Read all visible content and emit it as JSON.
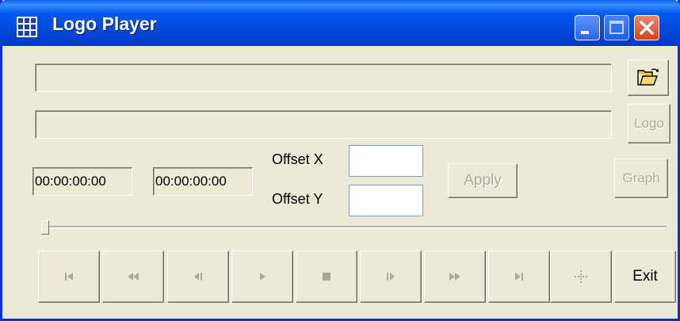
{
  "window": {
    "title": "Logo Player"
  },
  "labels": {
    "offset_x": "Offset X",
    "offset_y": "Offset Y"
  },
  "times": {
    "current": "00:00:00:00",
    "total": "00:00:00:00"
  },
  "buttons": {
    "logo": "Logo",
    "apply": "Apply",
    "graph": "Graph",
    "exit": "Exit"
  },
  "inputs": {
    "file_path": "",
    "logo_path": "",
    "offset_x": "",
    "offset_y": ""
  },
  "seek": {
    "position": 0
  },
  "transport": [
    "skip-to-start",
    "rewind",
    "step-back",
    "play",
    "stop",
    "step-forward",
    "fast-forward",
    "skip-to-end",
    "move"
  ],
  "colors": {
    "titlebar": "#0058ee",
    "window": "#ece9d8",
    "close": "#d5401c",
    "disabled_text": "#aca899"
  }
}
